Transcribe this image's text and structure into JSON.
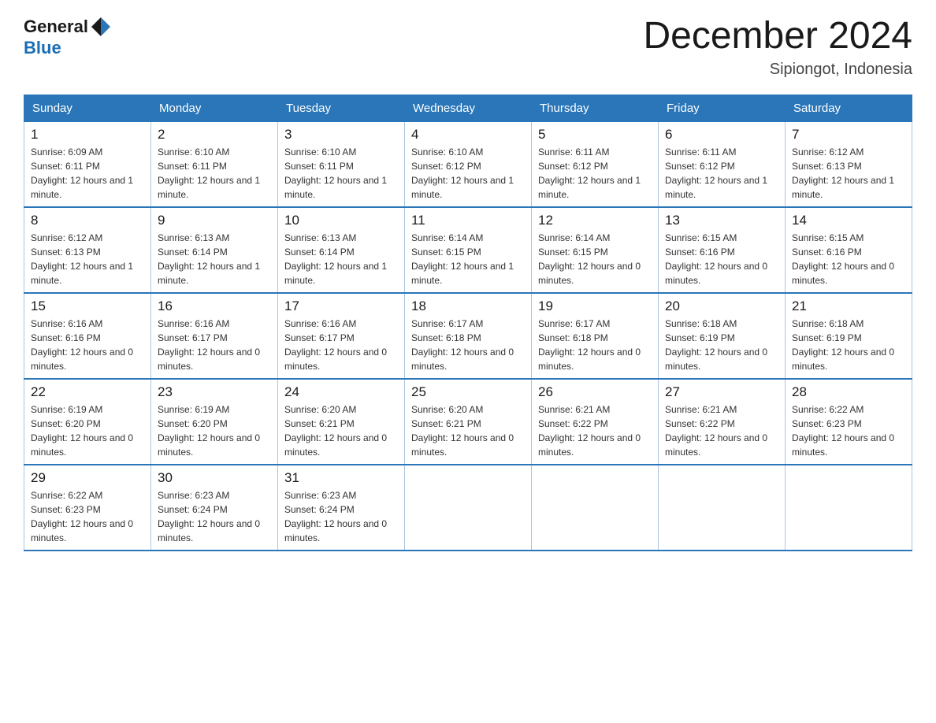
{
  "header": {
    "logo_general": "General",
    "logo_blue": "Blue",
    "title": "December 2024",
    "subtitle": "Sipiongot, Indonesia"
  },
  "weekdays": [
    "Sunday",
    "Monday",
    "Tuesday",
    "Wednesday",
    "Thursday",
    "Friday",
    "Saturday"
  ],
  "weeks": [
    [
      {
        "day": "1",
        "sunrise": "6:09 AM",
        "sunset": "6:11 PM",
        "daylight": "12 hours and 1 minute."
      },
      {
        "day": "2",
        "sunrise": "6:10 AM",
        "sunset": "6:11 PM",
        "daylight": "12 hours and 1 minute."
      },
      {
        "day": "3",
        "sunrise": "6:10 AM",
        "sunset": "6:11 PM",
        "daylight": "12 hours and 1 minute."
      },
      {
        "day": "4",
        "sunrise": "6:10 AM",
        "sunset": "6:12 PM",
        "daylight": "12 hours and 1 minute."
      },
      {
        "day": "5",
        "sunrise": "6:11 AM",
        "sunset": "6:12 PM",
        "daylight": "12 hours and 1 minute."
      },
      {
        "day": "6",
        "sunrise": "6:11 AM",
        "sunset": "6:12 PM",
        "daylight": "12 hours and 1 minute."
      },
      {
        "day": "7",
        "sunrise": "6:12 AM",
        "sunset": "6:13 PM",
        "daylight": "12 hours and 1 minute."
      }
    ],
    [
      {
        "day": "8",
        "sunrise": "6:12 AM",
        "sunset": "6:13 PM",
        "daylight": "12 hours and 1 minute."
      },
      {
        "day": "9",
        "sunrise": "6:13 AM",
        "sunset": "6:14 PM",
        "daylight": "12 hours and 1 minute."
      },
      {
        "day": "10",
        "sunrise": "6:13 AM",
        "sunset": "6:14 PM",
        "daylight": "12 hours and 1 minute."
      },
      {
        "day": "11",
        "sunrise": "6:14 AM",
        "sunset": "6:15 PM",
        "daylight": "12 hours and 1 minute."
      },
      {
        "day": "12",
        "sunrise": "6:14 AM",
        "sunset": "6:15 PM",
        "daylight": "12 hours and 0 minutes."
      },
      {
        "day": "13",
        "sunrise": "6:15 AM",
        "sunset": "6:16 PM",
        "daylight": "12 hours and 0 minutes."
      },
      {
        "day": "14",
        "sunrise": "6:15 AM",
        "sunset": "6:16 PM",
        "daylight": "12 hours and 0 minutes."
      }
    ],
    [
      {
        "day": "15",
        "sunrise": "6:16 AM",
        "sunset": "6:16 PM",
        "daylight": "12 hours and 0 minutes."
      },
      {
        "day": "16",
        "sunrise": "6:16 AM",
        "sunset": "6:17 PM",
        "daylight": "12 hours and 0 minutes."
      },
      {
        "day": "17",
        "sunrise": "6:16 AM",
        "sunset": "6:17 PM",
        "daylight": "12 hours and 0 minutes."
      },
      {
        "day": "18",
        "sunrise": "6:17 AM",
        "sunset": "6:18 PM",
        "daylight": "12 hours and 0 minutes."
      },
      {
        "day": "19",
        "sunrise": "6:17 AM",
        "sunset": "6:18 PM",
        "daylight": "12 hours and 0 minutes."
      },
      {
        "day": "20",
        "sunrise": "6:18 AM",
        "sunset": "6:19 PM",
        "daylight": "12 hours and 0 minutes."
      },
      {
        "day": "21",
        "sunrise": "6:18 AM",
        "sunset": "6:19 PM",
        "daylight": "12 hours and 0 minutes."
      }
    ],
    [
      {
        "day": "22",
        "sunrise": "6:19 AM",
        "sunset": "6:20 PM",
        "daylight": "12 hours and 0 minutes."
      },
      {
        "day": "23",
        "sunrise": "6:19 AM",
        "sunset": "6:20 PM",
        "daylight": "12 hours and 0 minutes."
      },
      {
        "day": "24",
        "sunrise": "6:20 AM",
        "sunset": "6:21 PM",
        "daylight": "12 hours and 0 minutes."
      },
      {
        "day": "25",
        "sunrise": "6:20 AM",
        "sunset": "6:21 PM",
        "daylight": "12 hours and 0 minutes."
      },
      {
        "day": "26",
        "sunrise": "6:21 AM",
        "sunset": "6:22 PM",
        "daylight": "12 hours and 0 minutes."
      },
      {
        "day": "27",
        "sunrise": "6:21 AM",
        "sunset": "6:22 PM",
        "daylight": "12 hours and 0 minutes."
      },
      {
        "day": "28",
        "sunrise": "6:22 AM",
        "sunset": "6:23 PM",
        "daylight": "12 hours and 0 minutes."
      }
    ],
    [
      {
        "day": "29",
        "sunrise": "6:22 AM",
        "sunset": "6:23 PM",
        "daylight": "12 hours and 0 minutes."
      },
      {
        "day": "30",
        "sunrise": "6:23 AM",
        "sunset": "6:24 PM",
        "daylight": "12 hours and 0 minutes."
      },
      {
        "day": "31",
        "sunrise": "6:23 AM",
        "sunset": "6:24 PM",
        "daylight": "12 hours and 0 minutes."
      },
      null,
      null,
      null,
      null
    ]
  ]
}
